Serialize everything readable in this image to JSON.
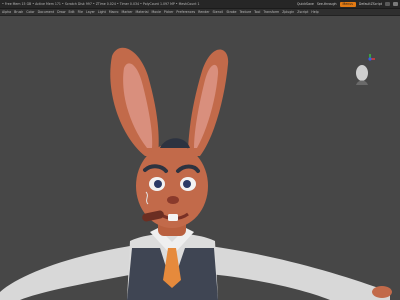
{
  "titlebar": {
    "info": "• Free Mem 15 GB • Active Mem 171 • Scratch Disk 997 • ZTime 0.024 • Timer 0.034 • PolyCount 1.097 MP • MeshCount 1",
    "quicksave_label": "QuickSave",
    "seethrough_label": "See-through",
    "menus_label": "Menus",
    "default_label": "DefaultZScript"
  },
  "menubar": {
    "items": [
      "Alpha",
      "Brush",
      "Color",
      "Document",
      "Draw",
      "Edit",
      "File",
      "Layer",
      "Light",
      "Macro",
      "Marker",
      "Material",
      "Movie",
      "Picker",
      "Preferences",
      "Render",
      "Stencil",
      "Stroke",
      "Texture",
      "Tool",
      "Transform",
      "Zplugin",
      "Zscript",
      "Help"
    ]
  },
  "colors": {
    "background": "#474747",
    "accent": "#e27a13",
    "skin": "#c26a4a",
    "shirt": "#dcdcdc",
    "vest": "#3f4553",
    "tie": "#e68a3c"
  },
  "icons": {
    "gizmo": "head-orientation-gizmo-icon"
  }
}
